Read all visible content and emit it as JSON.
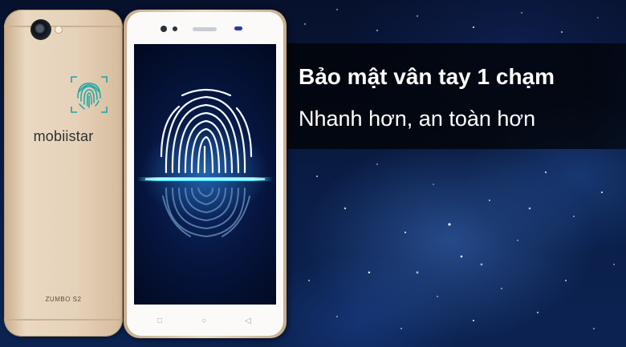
{
  "banner": {
    "headline": "Bảo mật vân tay 1 chạm",
    "subline": "Nhanh hơn, an toàn hơn"
  },
  "phone_back": {
    "brand": "mobiistar",
    "model": "ZUMBO S2"
  },
  "phone_front": {
    "nav_buttons": [
      "□",
      "○",
      "◁"
    ]
  },
  "colors": {
    "gold_body": "#e6d2ba",
    "scan_line": "#36e6ff",
    "fingerprint": "#ffffff",
    "sensor_teal": "#1aa6a8"
  }
}
